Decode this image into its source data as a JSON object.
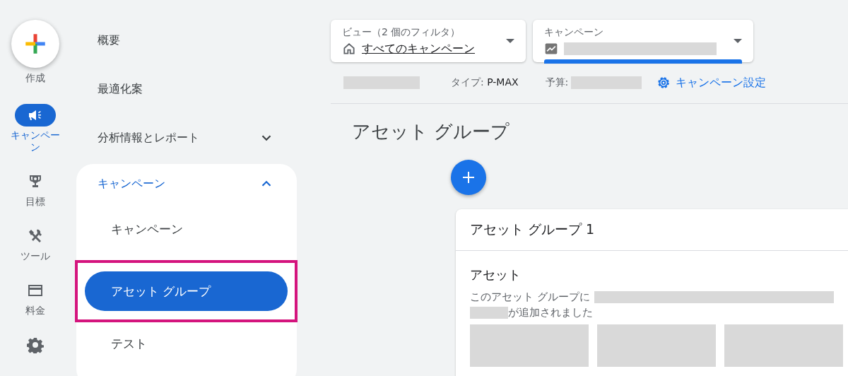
{
  "rail": {
    "create": {
      "label": "作成"
    },
    "items": [
      {
        "kind": "megaphone",
        "label": "キャンペーン",
        "selected": true
      },
      {
        "kind": "trophy",
        "label": "目標",
        "selected": false
      },
      {
        "kind": "tools",
        "label": "ツール",
        "selected": false
      },
      {
        "kind": "card",
        "label": "料金",
        "selected": false
      },
      {
        "kind": "gear",
        "selected": false
      }
    ]
  },
  "nav": {
    "items": [
      {
        "label": "概要"
      },
      {
        "label": "最適化案"
      },
      {
        "label": "分析情報とレポート",
        "expanded": false
      }
    ],
    "group": {
      "label": "キャンペーン",
      "expanded": true,
      "children": [
        {
          "label": "キャンペーン",
          "selected": false,
          "highlighted": false
        },
        {
          "label": "アセット グループ",
          "selected": true,
          "highlighted": true
        },
        {
          "label": "テスト",
          "selected": false,
          "highlighted": false
        }
      ]
    }
  },
  "filters": [
    {
      "label": "ビュー（2 個のフィルタ）",
      "kind": "link",
      "value": "すべてのキャンペーン",
      "active": false
    },
    {
      "label": "キャンペーン",
      "kind": "redacted",
      "active": true
    }
  ],
  "info": [
    {
      "kind": "redacted"
    },
    {
      "kind": "field",
      "label": "タイプ:",
      "value": "P-MAX"
    },
    {
      "kind": "field-redacted",
      "label": "予算:"
    },
    {
      "kind": "link",
      "label": "キャンペーン設定"
    }
  ],
  "page_title": "アセット グループ",
  "card": {
    "title": "アセット グループ 1",
    "section": "アセット",
    "text_before": "このアセット グループに",
    "text_after": "が追加されました",
    "tiles": [
      {
        "kind": "redacted"
      },
      {
        "kind": "redacted"
      },
      {
        "kind": "redacted"
      }
    ]
  }
}
